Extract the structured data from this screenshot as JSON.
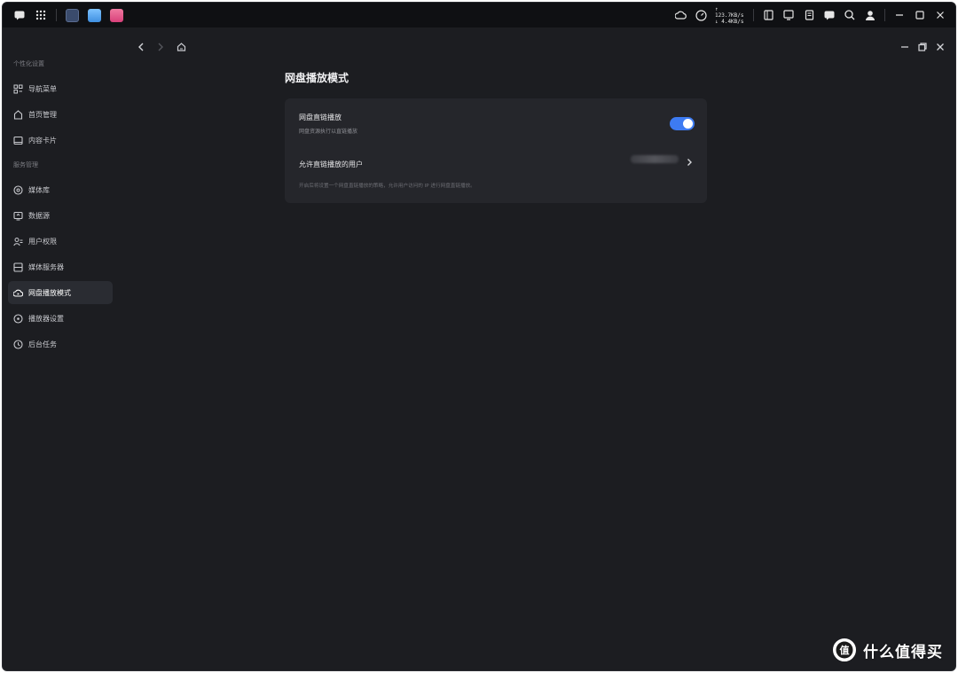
{
  "system_bar": {
    "left_icons": [
      "chat-icon",
      "apps-grid-icon"
    ],
    "apps": [
      {
        "name": "app-dark",
        "color": "#3a4b6c"
      },
      {
        "name": "app-sky",
        "color": "#4aa3f0"
      },
      {
        "name": "app-pink",
        "color": "#e35d8c"
      }
    ],
    "net_up": "↑ 123.7KB/s",
    "net_down": "↓ 4.4KB/s",
    "right_icons": [
      "storage-icon",
      "monitor-icon",
      "document-icon",
      "message-icon",
      "search-icon",
      "user-icon",
      "minimize-icon",
      "maximize-icon",
      "close-icon"
    ]
  },
  "sidebar": {
    "group1_title": "个性化设置",
    "group1_items": [
      {
        "label": "导航菜单",
        "icon": "menu-icon",
        "active": false
      },
      {
        "label": "首页管理",
        "icon": "home-icon",
        "active": false
      }
    ],
    "group2_title": "服务管理",
    "group2_items": [
      {
        "label": "媒体库",
        "icon": "media-icon",
        "active": false
      },
      {
        "label": "数据源",
        "icon": "datasource-icon",
        "active": false
      },
      {
        "label": "用户权限",
        "icon": "users-icon",
        "active": false
      },
      {
        "label": "媒体服务器",
        "icon": "server-icon",
        "active": false
      },
      {
        "label": "网盘播放模式",
        "icon": "cloud-play-icon",
        "active": true
      },
      {
        "label": "播放器设置",
        "icon": "player-icon",
        "active": false
      },
      {
        "label": "后台任务",
        "icon": "clock-icon",
        "active": false
      }
    ],
    "content_card_label": "内容卡片"
  },
  "main": {
    "title": "网盘播放模式",
    "direct_play_title": "网盘直链播放",
    "direct_play_desc": "网盘资源执行以直链播放",
    "direct_play_enabled": true,
    "allowed_users_label": "允许直链播放的用户",
    "note": "开启后将设置一个网盘直链播放的策略，允许用户访问的 IP 进行网盘直链播放。"
  },
  "watermark": {
    "text": "什么值得买",
    "logo": "值"
  },
  "colors": {
    "accent": "#3d7bf2",
    "background": "#1c1d21",
    "card": "#25262b"
  }
}
